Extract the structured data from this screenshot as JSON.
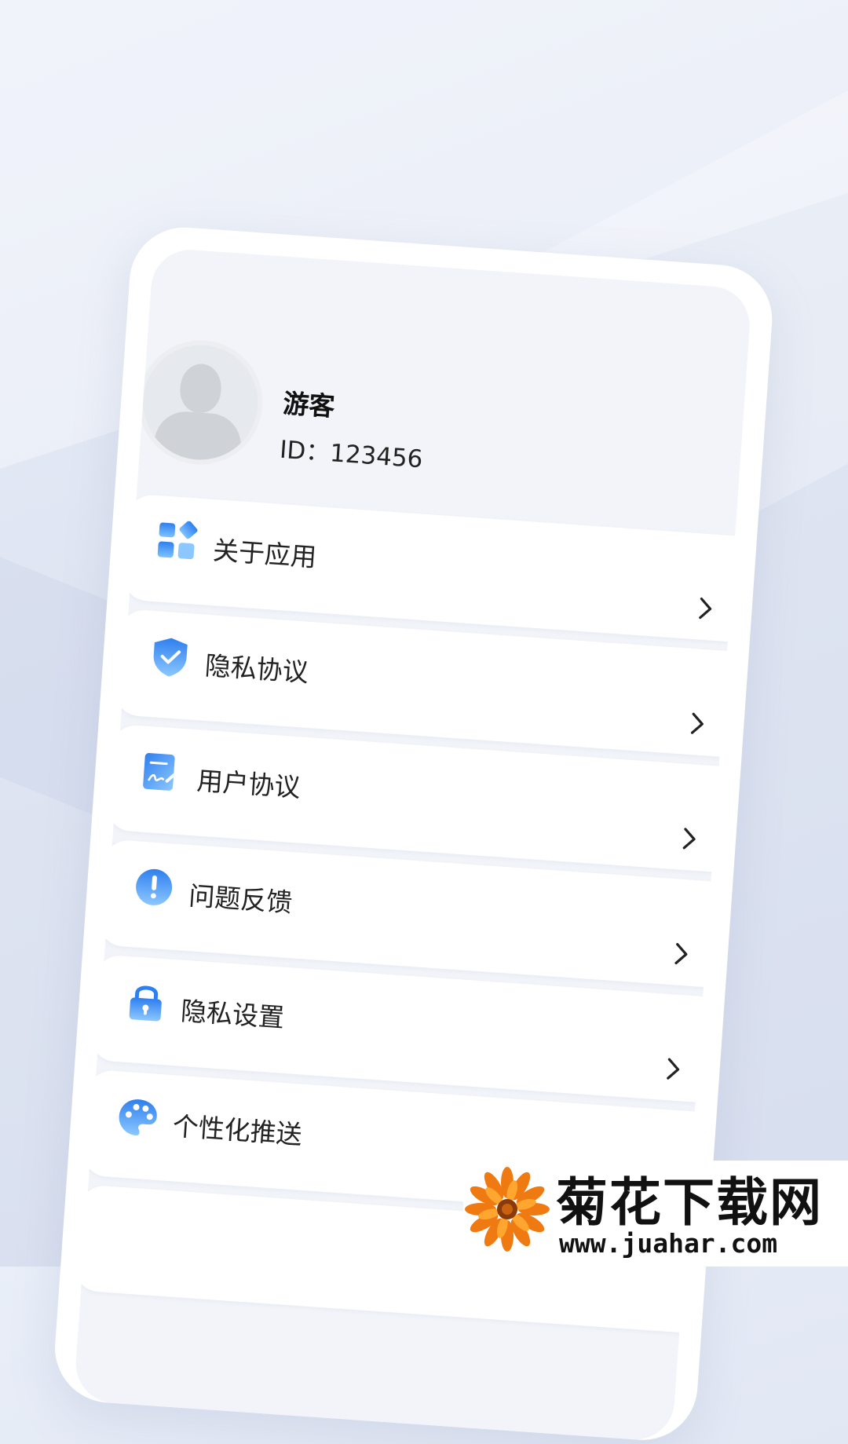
{
  "user": {
    "name": "游客",
    "id_label": "ID：",
    "id_value": "123456"
  },
  "menu": {
    "items": [
      {
        "label": "关于应用",
        "icon": "apps-icon"
      },
      {
        "label": "隐私协议",
        "icon": "shield-check-icon"
      },
      {
        "label": "用户协议",
        "icon": "document-sign-icon"
      },
      {
        "label": "问题反馈",
        "icon": "exclamation-icon"
      },
      {
        "label": "隐私设置",
        "icon": "lock-icon"
      },
      {
        "label": "个性化推送",
        "icon": "palette-icon"
      }
    ]
  },
  "watermark": {
    "title": "菊花下载网",
    "url": "www.juahar.com"
  },
  "colors": {
    "accent": "#3f8ef0",
    "accent_light": "#8cc7ff"
  }
}
